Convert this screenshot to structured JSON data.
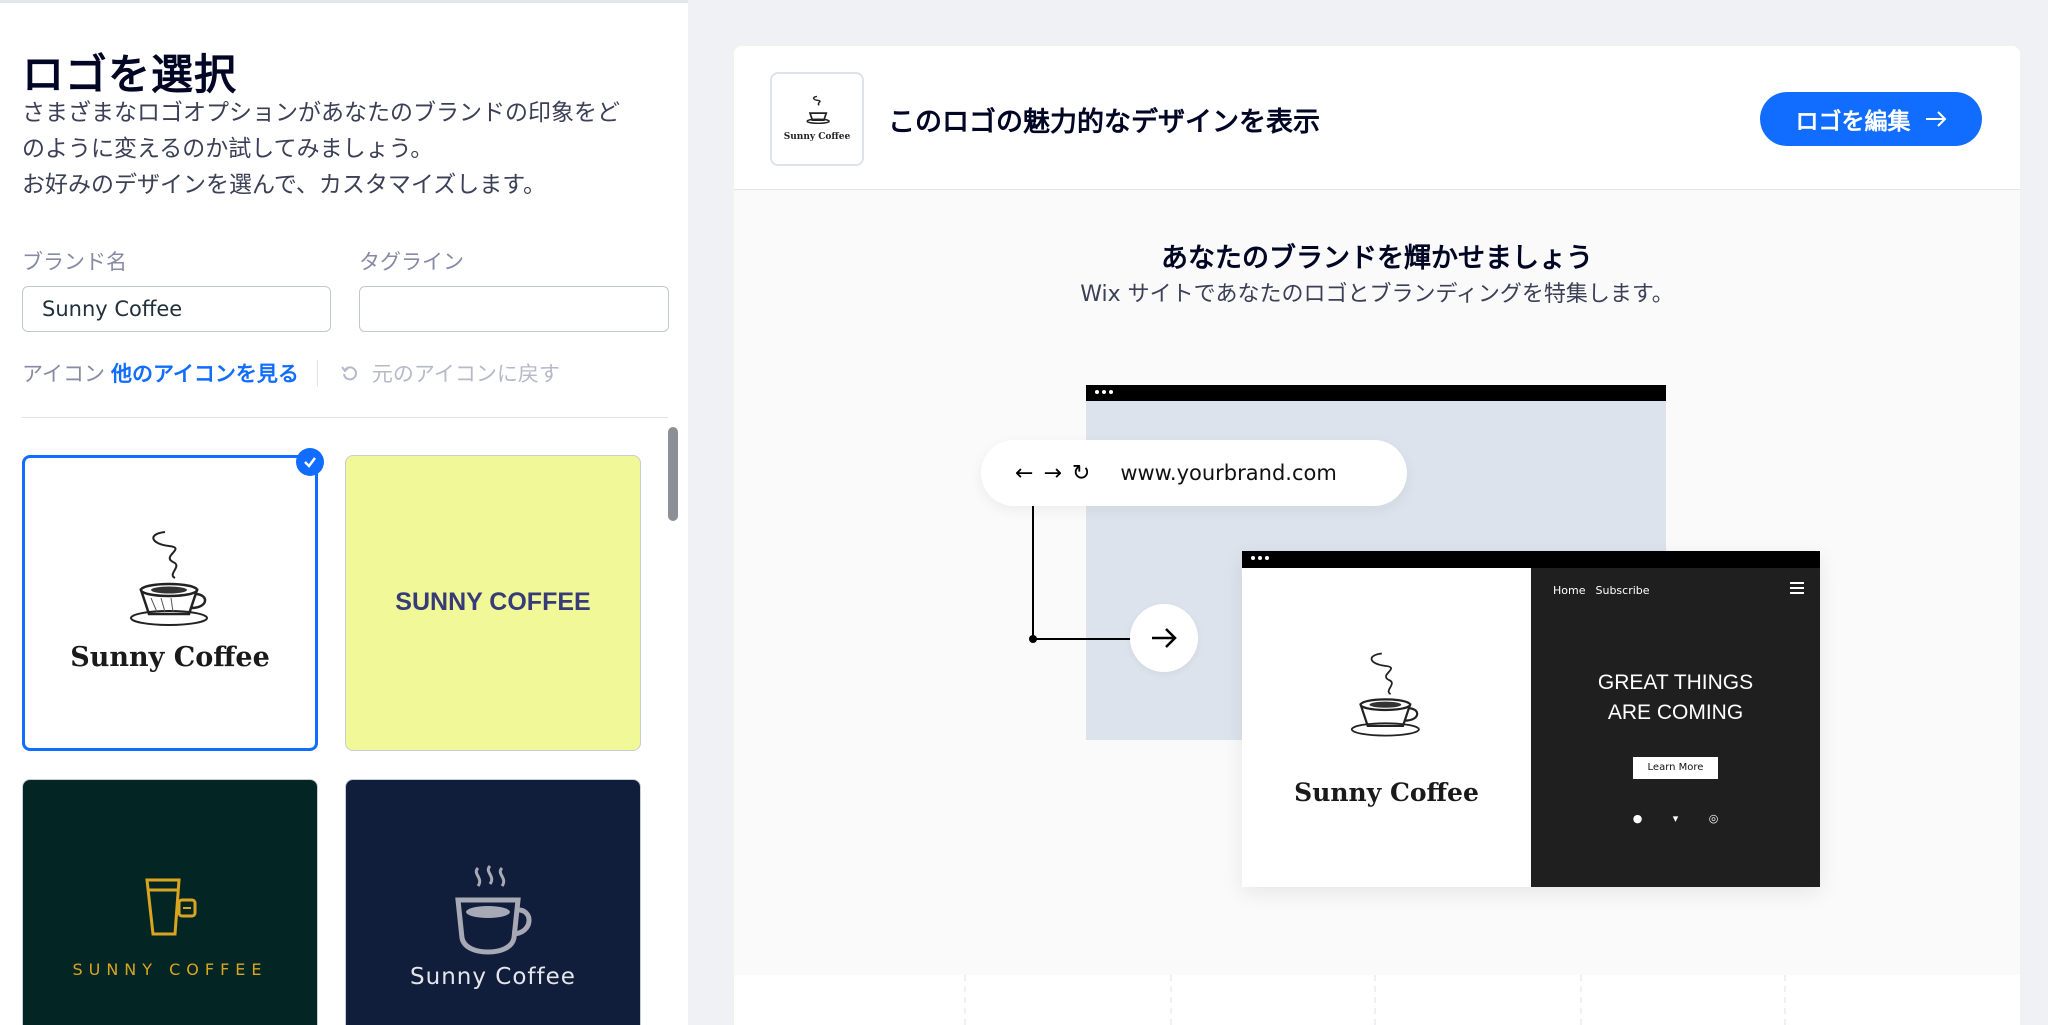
{
  "left_panel": {
    "title": "ロゴを選択",
    "description_line1": "さまざまなロゴオプションがあなたのブランドの印象をど",
    "description_line2": "のように変えるのか試してみましょう。",
    "description_line3": "お好みのデザインを選んで、カスタマイズします。",
    "brand_name_label": "ブランド名",
    "brand_name_value": "Sunny Coffee",
    "tagline_label": "タグライン",
    "tagline_value": "",
    "icon_label": "アイコン",
    "more_icons_link": "他のアイコンを見る",
    "revert_icon_label": "元のアイコンに戻す"
  },
  "logo_cards": [
    {
      "text": "Sunny Coffee",
      "selected": true,
      "background": "#ffffff"
    },
    {
      "text": "SUNNY COFFEE",
      "selected": false,
      "background": "#f1f898"
    },
    {
      "text": "SUNNY COFFEE",
      "selected": false,
      "background": "#032624"
    },
    {
      "text": "Sunny Coffee",
      "selected": false,
      "background": "#111e3b"
    }
  ],
  "right_panel": {
    "thumb_text": "Sunny Coffee",
    "header_title": "このロゴの魅力的なデザインを表示",
    "edit_button": "ロゴを編集",
    "headline": "あなたのブランドを輝かせましょう",
    "subline": "Wix サイトであなたのロゴとブランディングを特集します。",
    "url": "www.yourbrand.com",
    "mock_site": {
      "logo_text": "Sunny Coffee",
      "nav_home": "Home",
      "nav_subscribe": "Subscribe",
      "hero_line1": "GREAT THINGS",
      "hero_line2": "ARE COMING",
      "cta": "Learn More"
    }
  },
  "colors": {
    "accent": "#116dff",
    "heading": "#000624"
  }
}
